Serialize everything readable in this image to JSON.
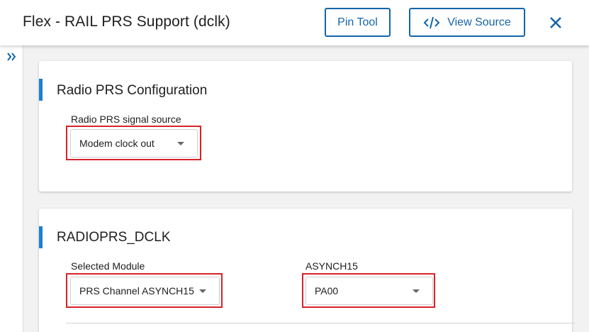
{
  "header": {
    "title": "Flex - RAIL PRS Support (dclk)",
    "pin_tool_label": "Pin Tool",
    "view_source_label": "View Source",
    "accent_color": "#1565a8"
  },
  "sections": [
    {
      "title": "Radio PRS Configuration",
      "fields": [
        {
          "label": "Radio PRS signal source",
          "value": "Modem clock out"
        }
      ]
    },
    {
      "title": "RADIOPRS_DCLK",
      "fields": [
        {
          "label": "Selected Module",
          "value": "PRS Channel ASYNCH15"
        },
        {
          "label": "ASYNCH15",
          "value": "PA00"
        }
      ]
    }
  ],
  "colors": {
    "highlight": "#d7232a",
    "section_accent": "#1b7fd1"
  },
  "icons": [
    "code-icon",
    "close-icon",
    "double-chevron-right-icon",
    "dropdown-caret-icon"
  ]
}
